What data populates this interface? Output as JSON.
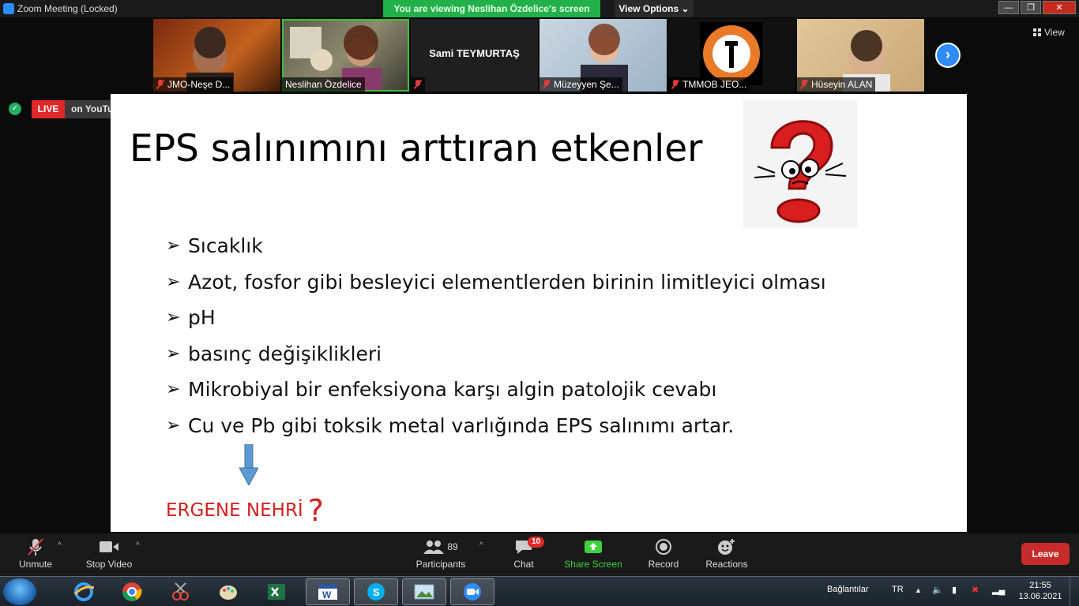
{
  "window": {
    "title": "Zoom Meeting (Locked)",
    "viewing_banner": "You are viewing Neslihan Özdelice's screen",
    "view_options": "View Options",
    "view_options_caret": "⌄",
    "controls": {
      "minimize": "—",
      "maximize": "❐",
      "close": "✕"
    }
  },
  "gallery": {
    "view_label": "View",
    "participants": [
      {
        "name": "JMO-Neşe D...",
        "muted": true
      },
      {
        "name": "Neslihan Özdelice",
        "muted": false
      },
      {
        "name": "Sami TEYMURTAŞ",
        "muted": true
      },
      {
        "name": "Müzeyyen Şe...",
        "muted": true
      },
      {
        "name": "TMMOB JEO...",
        "muted": true
      },
      {
        "name": "Hüseyin ALAN",
        "muted": true
      }
    ],
    "next_glyph": "›"
  },
  "live": {
    "badge": "LIVE",
    "platform": "on YouTube",
    "caret": "▾"
  },
  "slide": {
    "title": "EPS salınımını arttıran etkenler",
    "bullet_glyph": "➢",
    "bullets": [
      "Sıcaklık",
      "Azot, fosfor gibi besleyici elementlerden birinin limitleyici olması",
      "pH",
      "basınç değişiklikleri",
      "Mikrobiyal bir enfeksiyona karşı algin patolojik cevabı",
      "Cu ve Pb gibi toksik metal varlığında EPS salınımı artar."
    ],
    "footer_text": "ERGENE NEHRİ",
    "footer_mark": "?"
  },
  "toolbar": {
    "unmute": "Unmute",
    "stop_video": "Stop Video",
    "participants_label": "Participants",
    "participants_count": "89",
    "chat": "Chat",
    "chat_badge": "10",
    "share_screen": "Share Screen",
    "record": "Record",
    "reactions": "Reactions",
    "leave": "Leave",
    "caret_up": "^"
  },
  "taskbar": {
    "links_label": "Bağlantılar",
    "language": "TR",
    "time": "21:55",
    "date": "13.06.2021"
  },
  "colors": {
    "accent": "#2d8cff",
    "live": "#e02828",
    "banner": "#22b04b",
    "leave": "#c72b2b"
  }
}
